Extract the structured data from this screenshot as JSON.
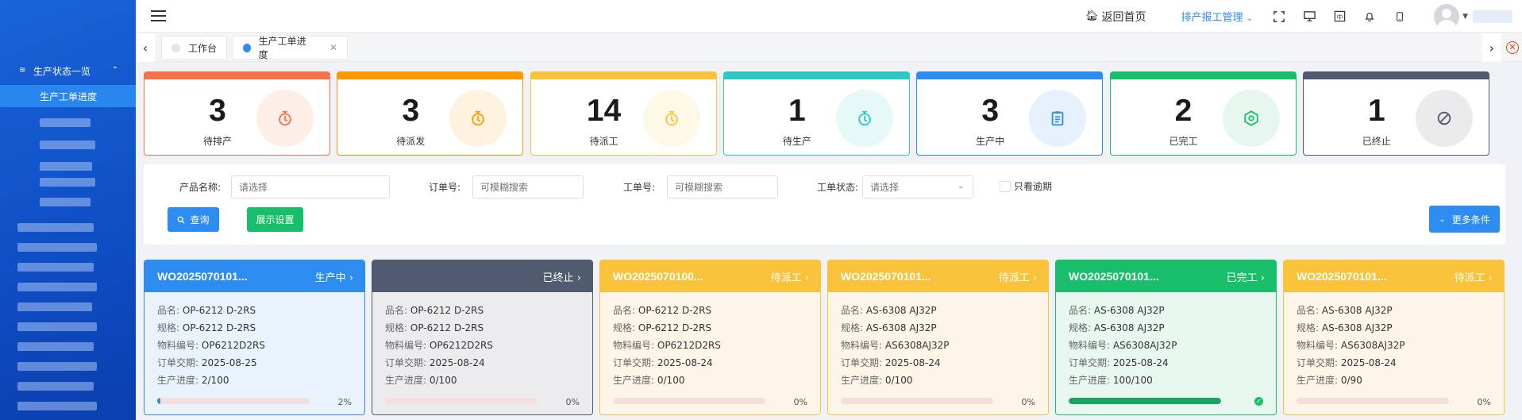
{
  "sidebar": {
    "group_label": "生产状态一览",
    "active_item": "生产工单进度"
  },
  "header": {
    "home_label": "返回首页",
    "menu_label": "排产报工管理"
  },
  "tabs": [
    {
      "label": "工作台"
    },
    {
      "label": "生产工单进度"
    }
  ],
  "stats": [
    {
      "count": "3",
      "label": "待排产",
      "color": "#f5734a",
      "bg": "#fdeee8",
      "icon": "stopwatch-icon"
    },
    {
      "count": "3",
      "label": "待派发",
      "color": "#ff9900",
      "bg": "#fff3e0",
      "icon": "stopwatch-icon"
    },
    {
      "count": "14",
      "label": "待派工",
      "color": "#f8c23b",
      "bg": "#fef8e6",
      "icon": "stopwatch-icon"
    },
    {
      "count": "1",
      "label": "待生产",
      "color": "#2ec8c1",
      "bg": "#e6f8f7",
      "icon": "stopwatch-icon"
    },
    {
      "count": "3",
      "label": "生产中",
      "color": "#2d8cf0",
      "bg": "#e7f1fd",
      "icon": "clipboard-icon"
    },
    {
      "count": "2",
      "label": "已完工",
      "color": "#19be6b",
      "bg": "#e5f7ee",
      "icon": "hexagon-icon"
    },
    {
      "count": "1",
      "label": "已终止",
      "color": "#515a6e",
      "bg": "#ebebed",
      "icon": "forbidden-icon"
    }
  ],
  "filters": {
    "product_label": "产品名称:",
    "product_placeholder": "请选择",
    "order_label": "订单号:",
    "order_placeholder": "可模糊搜索",
    "work_label": "工单号:",
    "work_placeholder": "可模糊搜索",
    "status_label": "工单状态:",
    "status_placeholder": "请选择",
    "overdue_label": "只看逾期",
    "query_button": "查询",
    "display_button": "展示设置",
    "more_button": "更多条件"
  },
  "card_keys": {
    "name": "品名:",
    "spec": "规格:",
    "material": "物料编号:",
    "due": "订单交期:",
    "progress": "生产进度:"
  },
  "cards": [
    {
      "wo": "WO2025070101...",
      "status": "生产中",
      "header_color": "#2d8cf0",
      "bg": "#eaf3fd",
      "border": "#2d8cf0",
      "name": "OP-6212 D-2RS",
      "spec": "OP-6212 D-2RS",
      "material": "OP6212D2RS",
      "due": "2025-08-25",
      "progress": "2/100",
      "percent": 2,
      "percent_label": "2%",
      "fill_color": "#2d8cf0"
    },
    {
      "wo": "",
      "status": "已终止",
      "header_color": "#515a6e",
      "bg": "#ececee",
      "border": "#515a6e",
      "name": "OP-6212 D-2RS",
      "spec": "OP-6212 D-2RS",
      "material": "OP6212D2RS",
      "due": "2025-08-24",
      "progress": "0/100",
      "percent": 0,
      "percent_label": "0%",
      "fill_color": "#f4dede"
    },
    {
      "wo": "WO2025070100...",
      "status": "待派工",
      "header_color": "#f8c23b",
      "bg": "#fdf6e8",
      "border": "#f8c23b",
      "name": "OP-6212 D-2RS",
      "spec": "OP-6212 D-2RS",
      "material": "OP6212D2RS",
      "due": "2025-08-24",
      "progress": "0/100",
      "percent": 0,
      "percent_label": "0%",
      "fill_color": "#f4dede"
    },
    {
      "wo": "WO2025070101...",
      "status": "待派工",
      "header_color": "#f8c23b",
      "bg": "#fdf6e8",
      "border": "#f8c23b",
      "name": "AS-6308 AJ32P",
      "spec": "AS-6308 AJ32P",
      "material": "AS6308AJ32P",
      "due": "2025-08-24",
      "progress": "0/100",
      "percent": 0,
      "percent_label": "0%",
      "fill_color": "#f4dede"
    },
    {
      "wo": "WO2025070101...",
      "status": "已完工",
      "header_color": "#19be6b",
      "bg": "#e8f7ef",
      "border": "#19be6b",
      "name": "AS-6308 AJ32P",
      "spec": "AS-6308 AJ32P",
      "material": "AS6308AJ32P",
      "due": "2025-08-24",
      "progress": "100/100",
      "percent": 100,
      "percent_label": "",
      "fill_color": "#1aa564"
    },
    {
      "wo": "WO2025070101...",
      "status": "待派工",
      "header_color": "#f8c23b",
      "bg": "#fdf6e8",
      "border": "#f8c23b",
      "name": "AS-6308 AJ32P",
      "spec": "AS-6308 AJ32P",
      "material": "AS6308AJ32P",
      "due": "2025-08-24",
      "progress": "0/90",
      "percent": 0,
      "percent_label": "0%",
      "fill_color": "#f4dede"
    }
  ]
}
